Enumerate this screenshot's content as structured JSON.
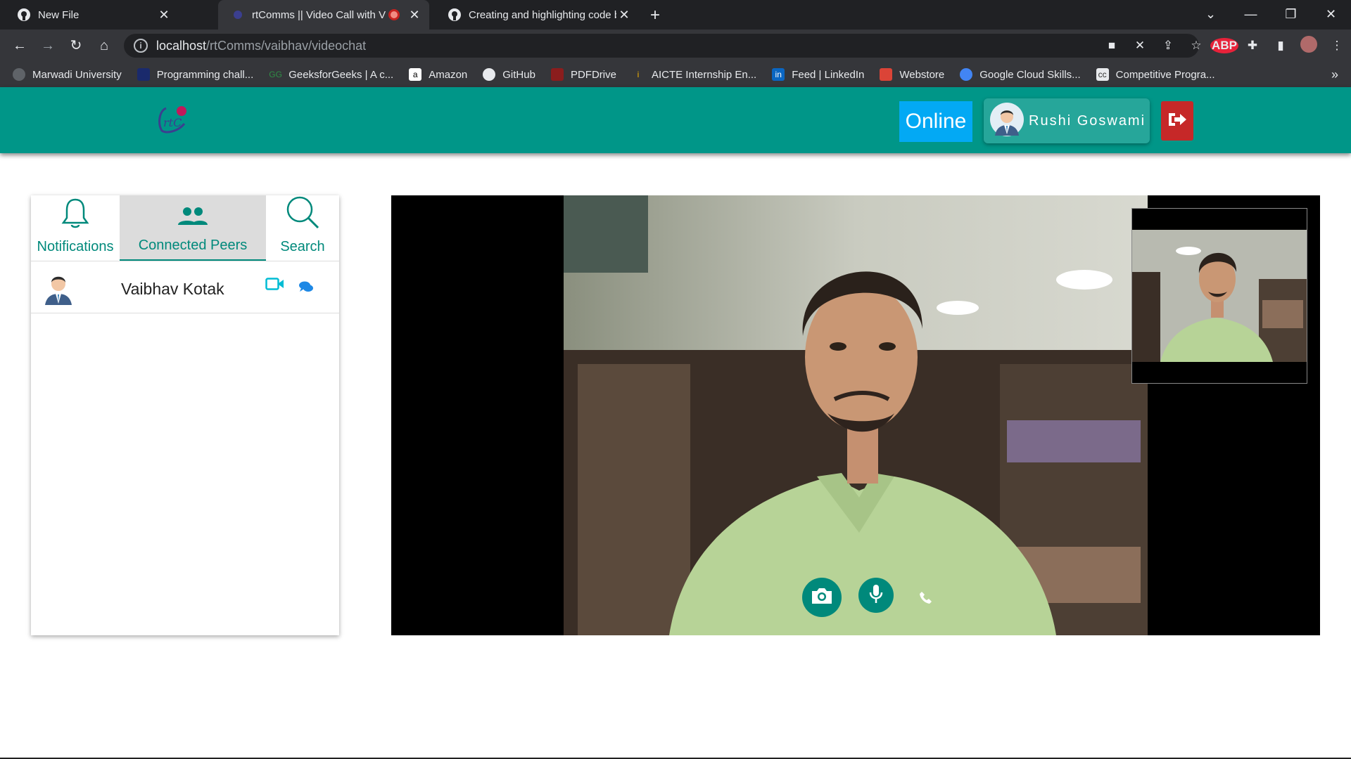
{
  "browser": {
    "tabs": [
      {
        "title": "New File",
        "icon": "github-icon",
        "active": false
      },
      {
        "title": "rtComms || Video Call with V",
        "icon": "rtcomms-icon",
        "active": true,
        "recording": true
      },
      {
        "title": "Creating and highlighting code b",
        "icon": "github-icon",
        "active": false
      }
    ],
    "url_host": "localhost",
    "url_path": "/rtComms/vaibhav/videochat",
    "bookmarks": [
      {
        "label": "Marwadi University",
        "icon": "globe-icon"
      },
      {
        "label": "Programming chall...",
        "icon": "code-icon"
      },
      {
        "label": "GeeksforGeeks | A c...",
        "icon": "gfg-icon"
      },
      {
        "label": "Amazon",
        "icon": "amazon-icon"
      },
      {
        "label": "GitHub",
        "icon": "github-icon"
      },
      {
        "label": "PDFDrive",
        "icon": "pdf-icon"
      },
      {
        "label": "AICTE Internship En...",
        "icon": "aicte-icon"
      },
      {
        "label": "Feed | LinkedIn",
        "icon": "linkedin-icon"
      },
      {
        "label": "Webstore",
        "icon": "webstore-icon"
      },
      {
        "label": "Google Cloud Skills...",
        "icon": "google-cloud-icon"
      },
      {
        "label": "Competitive Progra...",
        "icon": "cc-icon"
      }
    ],
    "abp_label": "ABP"
  },
  "navbar": {
    "logo_text": "rtC",
    "status_label": "Online",
    "user_name": "Rushi Goswami"
  },
  "sidebar": {
    "tabs": [
      {
        "label": "Notifications",
        "icon": "bell-icon",
        "selected": false
      },
      {
        "label": "Connected Peers",
        "icon": "people-icon",
        "selected": true
      },
      {
        "label": "Search",
        "icon": "search-icon",
        "selected": false
      }
    ],
    "peers": [
      {
        "name": "Vaibhav Kotak"
      }
    ]
  },
  "call": {
    "controls": [
      "camera-icon",
      "mic-icon",
      "phone-icon"
    ]
  },
  "colors": {
    "primary": "#009688",
    "online": "#03a9f4",
    "logout": "#c62828",
    "accent": "#00bcd4"
  }
}
